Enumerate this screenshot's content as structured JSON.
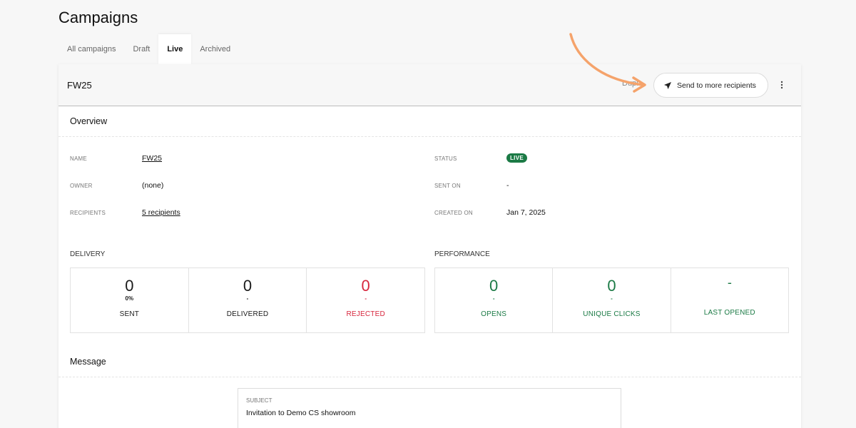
{
  "page": {
    "title": "Campaigns"
  },
  "tabs": [
    {
      "label": "All campaigns",
      "active": false
    },
    {
      "label": "Draft",
      "active": false
    },
    {
      "label": "Live",
      "active": true
    },
    {
      "label": "Archived",
      "active": false
    }
  ],
  "campaign": {
    "title": "FW25",
    "hidden_action_label": "Dupl",
    "send_button_label": "Send to more recipients"
  },
  "overview": {
    "title": "Overview",
    "name_label": "NAME",
    "name_value": "FW25",
    "owner_label": "OWNER",
    "owner_value": "(none)",
    "recipients_label": "RECIPIENTS",
    "recipients_value": "5 recipients",
    "status_label": "STATUS",
    "status_value": "LIVE",
    "sent_on_label": "SENT ON",
    "sent_on_value": "-",
    "created_on_label": "CREATED ON",
    "created_on_value": "Jan 7, 2025"
  },
  "delivery": {
    "title": "DELIVERY",
    "stats": [
      {
        "value": "0",
        "sub": "0%",
        "label": "SENT"
      },
      {
        "value": "0",
        "sub": "-",
        "label": "DELIVERED"
      },
      {
        "value": "0",
        "sub": "-",
        "label": "REJECTED"
      }
    ]
  },
  "performance": {
    "title": "PERFORMANCE",
    "stats": [
      {
        "value": "0",
        "sub": "-",
        "label": "OPENS"
      },
      {
        "value": "0",
        "sub": "-",
        "label": "UNIQUE CLICKS"
      },
      {
        "value": "-",
        "sub": "",
        "label": "LAST OPENED"
      }
    ]
  },
  "message": {
    "title": "Message",
    "subject_label": "SUBJECT",
    "subject_value": "Invitation to Demo CS showroom"
  },
  "colors": {
    "accent_green": "#1b7a45",
    "error_red": "#d7263d",
    "annotation_orange": "#f5a36b"
  },
  "icons": {
    "send": "paper-plane-icon",
    "more": "vertical-dots-icon",
    "annotation": "curved-arrow-icon"
  }
}
